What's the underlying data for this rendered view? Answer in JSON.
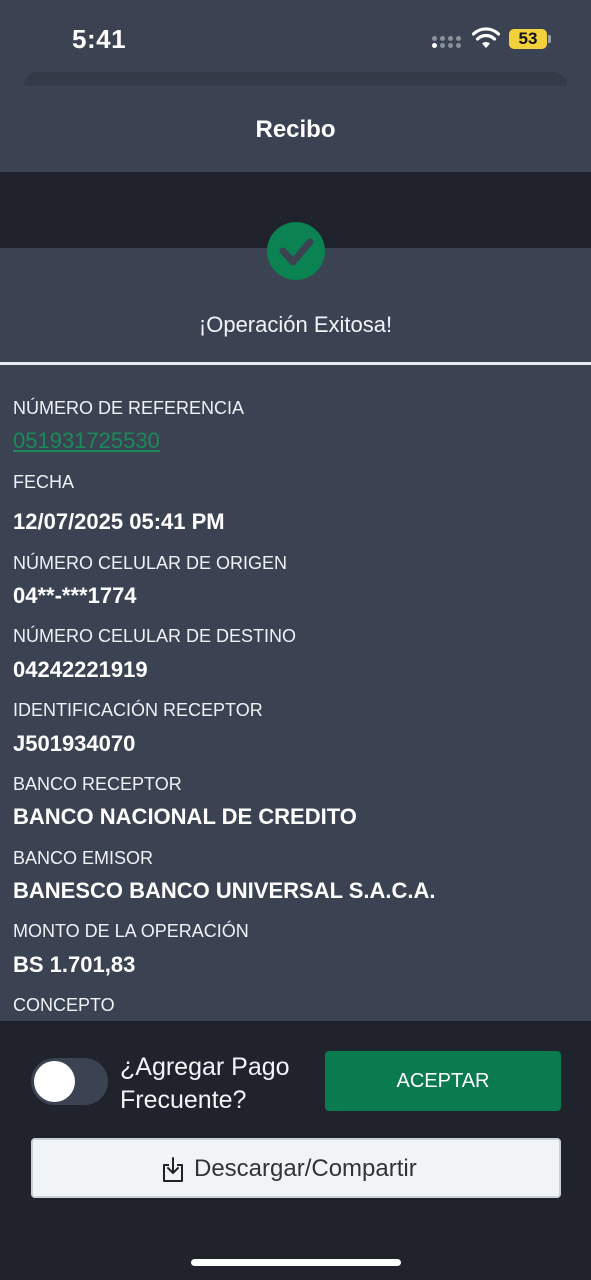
{
  "status_bar": {
    "time": "5:41",
    "battery": "53"
  },
  "header": {
    "title": "Recibo"
  },
  "success": {
    "message": "¡Operación Exitosa!"
  },
  "fields": [
    {
      "label": "NÚMERO DE REFERENCIA",
      "value": "051931725530"
    },
    {
      "label": "FECHA",
      "value": "12/07/2025 05:41 PM"
    },
    {
      "label": "NÚMERO CELULAR DE ORIGEN",
      "value": "04**-***1774"
    },
    {
      "label": "NÚMERO CELULAR DE DESTINO",
      "value": "04242221919"
    },
    {
      "label": "IDENTIFICACIÓN RECEPTOR",
      "value": "J501934070"
    },
    {
      "label": "BANCO RECEPTOR",
      "value": "BANCO NACIONAL DE CREDITO"
    },
    {
      "label": "BANCO EMISOR",
      "value": "BANESCO BANCO UNIVERSAL S.A.C.A."
    },
    {
      "label": "MONTO DE LA OPERACIÓN",
      "value": "BS 1.701,83"
    },
    {
      "label": "CONCEPTO",
      "value": ""
    }
  ],
  "footer": {
    "toggle_label": "¿Agregar Pago Frecuente?",
    "toggle_on": false,
    "accept_label": "ACEPTAR",
    "download_label": "Descargar/Compartir"
  },
  "colors": {
    "accent": "#0a7a4f",
    "background": "#3b4353",
    "dark": "#20232b",
    "link": "#1a8a58"
  },
  "icons": {
    "success": "check-circle-icon",
    "download": "download-share-icon"
  }
}
